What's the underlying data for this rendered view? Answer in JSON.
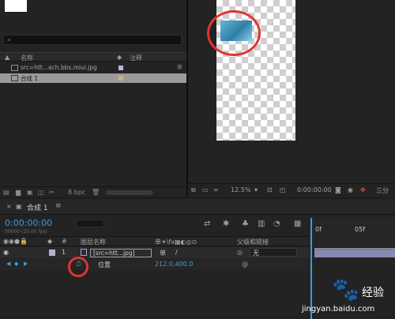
{
  "project": {
    "search_icon": "⌕",
    "col_name": "名称",
    "col_comment": "注释",
    "items": [
      {
        "label": "src=htt...ach.bbs.miui.jpg",
        "swatch": "#c0b4e0"
      },
      {
        "label": "合成 1",
        "swatch": "#c8b090"
      }
    ],
    "bpc": "8 bpc"
  },
  "viewer": {
    "zoom": "12.5%",
    "timecode": "0:00:00:00",
    "view_label": "三分"
  },
  "timeline": {
    "tab_label": "合成 1",
    "menu_icon": "≡",
    "timecode": "0:00:00:00",
    "fps": "00000 (25.00 fps)",
    "col_layer_name": "图层名称",
    "col_parent": "父级和链接",
    "layer_index": "1",
    "layer_name": "[src=htt...jpg]",
    "parent_value": "无",
    "prop_name": "位置",
    "prop_value": "212.0,400.0",
    "ruler_0": "0f",
    "ruler_5": "05f"
  },
  "watermark": {
    "text": "jingyan.baidu.com",
    "brand": "经验"
  }
}
